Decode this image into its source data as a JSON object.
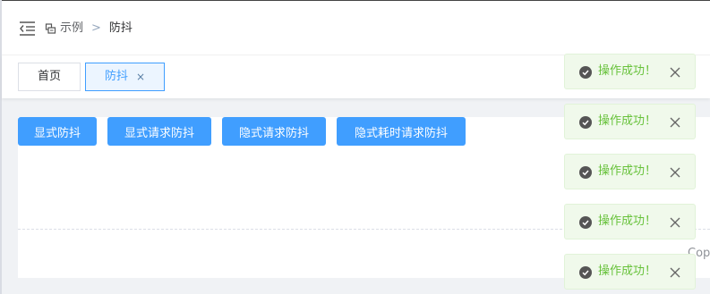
{
  "breadcrumb": {
    "items": [
      "示例",
      "防抖"
    ],
    "separator": ">"
  },
  "tabs": [
    {
      "label": "首页",
      "active": false
    },
    {
      "label": "防抖",
      "active": true,
      "close_glyph": "×"
    }
  ],
  "buttons": [
    {
      "label": "显式防抖"
    },
    {
      "label": "显式请求防抖"
    },
    {
      "label": "隐式请求防抖"
    },
    {
      "label": "隐式耗时请求防抖"
    }
  ],
  "footer": {
    "copyright": "Cop"
  },
  "toasts": [
    {
      "text": "操作成功！"
    },
    {
      "text": "操作成功！"
    },
    {
      "text": "操作成功！"
    },
    {
      "text": "操作成功！"
    },
    {
      "text": "操作成功！"
    }
  ],
  "icons": {
    "menu": "menu-fold-icon",
    "breadcrumb": "example-icon",
    "toast": "success-icon",
    "toast_close": "close-icon"
  },
  "colors": {
    "primary": "#409eff",
    "success_text": "#67c23a",
    "success_bg": "#f0f9eb",
    "active_tab_bg": "#ecf5ff"
  }
}
